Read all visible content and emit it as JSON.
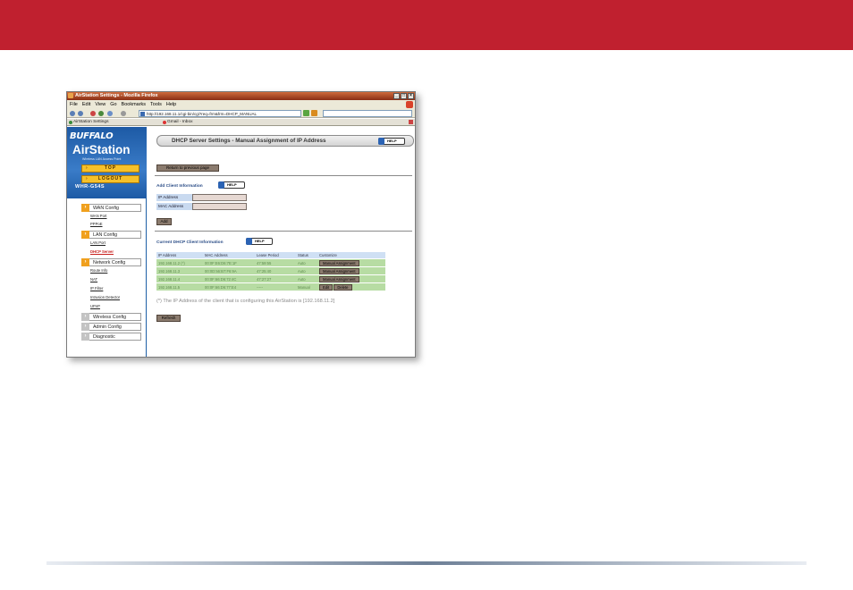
{
  "browser": {
    "title": "AirStation Settings - Mozilla Firefox",
    "menu": [
      "File",
      "Edit",
      "View",
      "Go",
      "Bookmarks",
      "Tools",
      "Help"
    ],
    "url": "http://192.168.11.1/cgi-bin/cgi?req=frm&frm=DHCP_MANUAL",
    "tabs": [
      "AirStation Settings",
      "Gmail - Inbox"
    ]
  },
  "sidebar": {
    "brand": "BUFFALO",
    "product": "AirStation",
    "subtitle": "Wireless LAN Access Point",
    "top_btn": "TOP",
    "logout_btn": "LOGOUT",
    "model": "WHR-G54S",
    "sections": [
      {
        "label": "WAN Config",
        "items": [
          "WAN Port",
          "PPPoE"
        ]
      },
      {
        "label": "LAN Config",
        "items": [
          "LAN Port",
          "DHCP Server"
        ]
      },
      {
        "label": "Network Config",
        "items": [
          "Route Info",
          "NAT",
          "IP Filter",
          "Intrusion Detector",
          "UPnP"
        ]
      },
      {
        "label": "Wireless Config",
        "items": []
      },
      {
        "label": "Admin Config",
        "items": []
      },
      {
        "label": "Diagnostic",
        "items": []
      }
    ]
  },
  "main": {
    "title": "DHCP Server Settings - Manual Assignment of IP Address",
    "help": "HELP",
    "return_btn": "Return to previous page",
    "add_title": "Add Client Information",
    "ip_label": "IP Address",
    "mac_label": "MAC Address",
    "add_btn": "Add",
    "current_title": "Current DHCP Client Information",
    "columns": [
      "IP Address",
      "MAC Address",
      "Lease Period",
      "Status",
      "Customize"
    ],
    "rows": [
      {
        "ip": "192.168.11.2 (*)",
        "mac": "00:0F:E6:D6:7E:1F",
        "lease": "47:59:55",
        "status": "Auto",
        "actions": [
          "Manual Assignment"
        ]
      },
      {
        "ip": "192.168.11.3",
        "mac": "00:0D:56:B7:F6:9A",
        "lease": "47:25:40",
        "status": "Auto",
        "actions": [
          "Manual Assignment"
        ]
      },
      {
        "ip": "192.168.11.4",
        "mac": "00:0F:66:D6:72:4C",
        "lease": "47:27:27",
        "status": "Auto",
        "actions": [
          "Manual Assignment"
        ]
      },
      {
        "ip": "192.168.11.5",
        "mac": "00:0F:66:D6:77:E4",
        "lease": "-----",
        "status": "Manual",
        "actions": [
          "Edit",
          "Delete"
        ]
      }
    ],
    "note": "(*) The IP Address of the client that is configuring this AirStation is [192.168.11.2]",
    "refresh_btn": "Refresh"
  },
  "colors": {
    "slide_band": "#c0202f",
    "brand_blue": "#1d5aa5",
    "row_green": "#b7dca3"
  }
}
